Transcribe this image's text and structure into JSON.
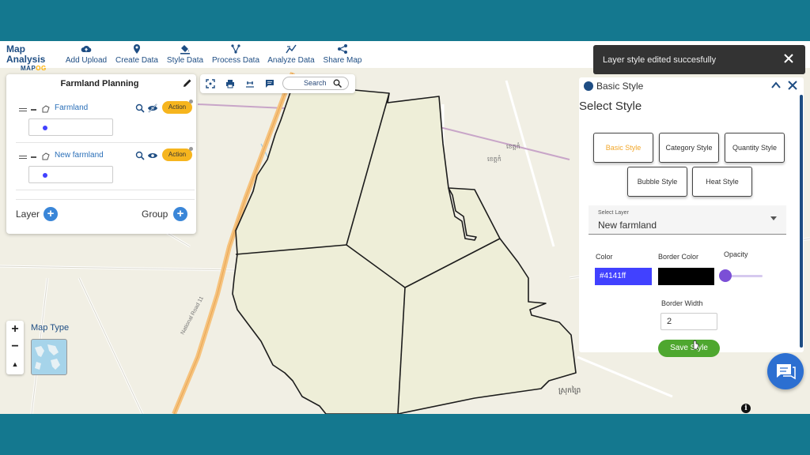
{
  "brand": {
    "title": "Map Analysis",
    "subtitle_prefix": "MAP",
    "subtitle_accent": "OG"
  },
  "toolbar": [
    {
      "label": "Add Upload",
      "icon": "cloud-upload-icon"
    },
    {
      "label": "Create Data",
      "icon": "map-pin-icon"
    },
    {
      "label": "Style Data",
      "icon": "paint-bucket-icon"
    },
    {
      "label": "Process Data",
      "icon": "process-nodes-icon"
    },
    {
      "label": "Analyze Data",
      "icon": "analyze-icon"
    },
    {
      "label": "Share Map",
      "icon": "share-icon"
    }
  ],
  "layer_panel": {
    "title": "Farmland Planning",
    "layers": [
      {
        "name": "Farmland",
        "action": "Action",
        "swatch_color": "#4141ff",
        "visible": false
      },
      {
        "name": "New farmland",
        "action": "Action",
        "swatch_color": "#4141ff",
        "visible": true
      }
    ],
    "footer_layer": "Layer",
    "footer_group": "Group"
  },
  "map_tools": {
    "search_label": "Search"
  },
  "map_controls": {
    "zoom_in": "+",
    "zoom_out": "−",
    "reset": "▲",
    "map_type_label": "Map Type"
  },
  "map_labels": {
    "road": "National Road 11",
    "place1": "ខេត្តកំ",
    "place2": "ខេត្តកំ",
    "place3": "ស្រុកព្រៃ"
  },
  "toast": {
    "message": "Layer style edited succesfully"
  },
  "style_panel": {
    "header": "Basic Style",
    "title": "Select Style",
    "styles": [
      {
        "label": "Basic Style",
        "active": true
      },
      {
        "label": "Category Style",
        "active": false
      },
      {
        "label": "Quantity Style",
        "active": false
      },
      {
        "label": "Bubble Style",
        "active": false
      },
      {
        "label": "Heat Style",
        "active": false
      }
    ],
    "select_layer_label": "Select Layer",
    "selected_layer": "New farmland",
    "color_label": "Color",
    "color_value": "#4141ff",
    "border_color_label": "Border Color",
    "border_color_value": "#000000",
    "opacity_label": "Opacity",
    "opacity_value": 0,
    "border_width_label": "Border Width",
    "border_width_value": "2",
    "save_label": "Save Style"
  },
  "colors": {
    "brand": "#1e4d83",
    "accent": "#f6b51e",
    "save": "#4ea72f",
    "frame": "#14788f"
  }
}
